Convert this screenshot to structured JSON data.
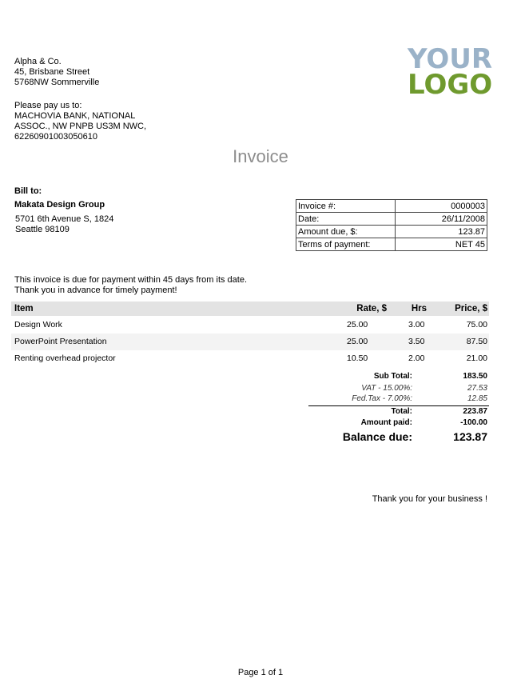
{
  "company": {
    "name": "Alpha & Co.",
    "street": "45, Brisbane Street",
    "city": "5768NW Sommerville"
  },
  "payment": {
    "intro": "Please pay us to:",
    "line1": "MACHOVIA BANK, NATIONAL",
    "line2": "ASSOC., NW PNPB US3M NWC,",
    "account": "62260901003050610"
  },
  "logo": {
    "line1": "YOUR",
    "line2": "LOGO",
    "color1": "#9ab2c8",
    "color2": "#6f9a2e"
  },
  "title": "Invoice",
  "bill_to": {
    "label": "Bill to:",
    "name": "Makata Design Group",
    "address1": "5701 6th Avenue S, 1824",
    "address2": "Seattle  98109"
  },
  "info": [
    {
      "label": "Invoice #:",
      "value": "0000003"
    },
    {
      "label": "Date:",
      "value": "26/11/2008"
    },
    {
      "label": "Amount due, $:",
      "value": "123.87"
    },
    {
      "label": "Terms of payment:",
      "value": "NET 45"
    }
  ],
  "notes": {
    "line1": "This invoice is due for payment within 45 days from its date.",
    "line2": "Thank you in advance for timely payment!"
  },
  "items": {
    "headers": {
      "item": "Item",
      "rate": "Rate, $",
      "hrs": "Hrs",
      "price": "Price, $"
    },
    "rows": [
      {
        "item": "Design Work",
        "rate": "25.00",
        "hrs": "3.00",
        "price": "75.00"
      },
      {
        "item": "PowerPoint Presentation",
        "rate": "25.00",
        "hrs": "3.50",
        "price": "87.50"
      },
      {
        "item": "Renting overhead projector",
        "rate": "10.50",
        "hrs": "2.00",
        "price": "21.00"
      }
    ]
  },
  "totals": {
    "subtotal_label": "Sub Total:",
    "subtotal": "183.50",
    "vat_label": "VAT - 15.00%:",
    "vat": "27.53",
    "fed_label": "Fed.Tax - 7.00%:",
    "fed": "12.85",
    "total_label": "Total:",
    "total": "223.87",
    "paid_label": "Amount paid:",
    "paid": "-100.00",
    "balance_label": "Balance due:",
    "balance": "123.87"
  },
  "thanks": "Thank you for your business !",
  "pager": "Page 1 of 1"
}
